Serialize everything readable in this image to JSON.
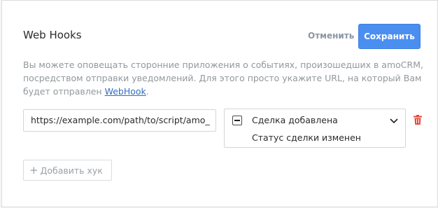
{
  "header": {
    "title": "Web Hooks",
    "cancel_label": "Отменить",
    "save_label": "Сохранить"
  },
  "description": {
    "text": "Вы можете оповещать сторонние приложения о событиях, произошедших в amoCRM, посредством отправки уведомлений. Для этого просто укажите URL, на который Вам будет отправлен ",
    "link_text": "WebHook",
    "suffix": "."
  },
  "hook": {
    "url_value": "https://example.com/path/to/script/amo_",
    "events": [
      {
        "label": "Сделка добавлена",
        "checkbox_state": "indeterminate"
      },
      {
        "label": "Статус сделки изменен"
      }
    ],
    "delete_icon": "trash-icon"
  },
  "add_button": {
    "label": "Добавить хук",
    "icon": "plus-icon"
  },
  "colors": {
    "accent": "#4a8ff0",
    "link": "#2f6ec0",
    "danger": "#e74c3c",
    "muted_text": "#92989b"
  }
}
